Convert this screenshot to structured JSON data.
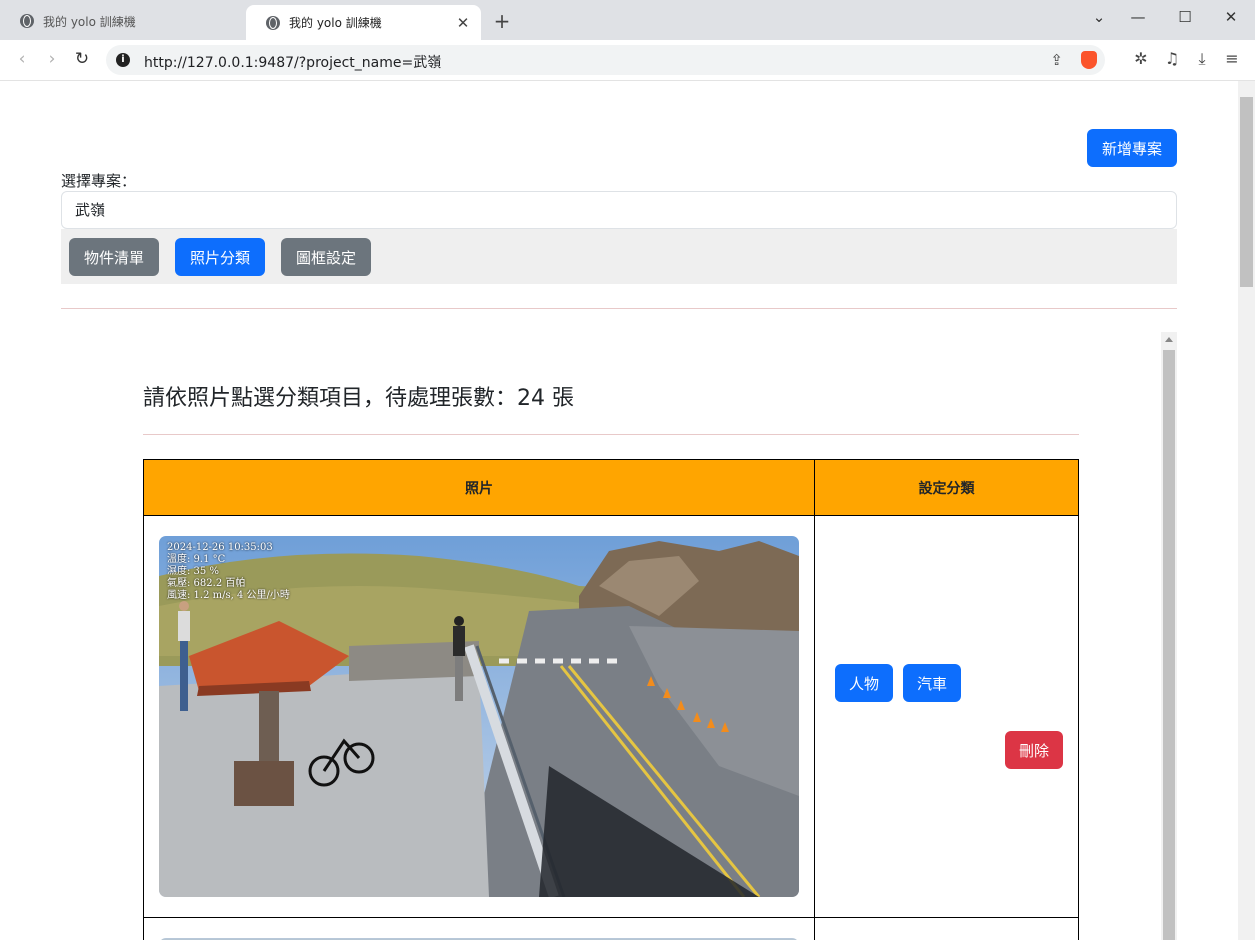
{
  "browser": {
    "tabs": [
      {
        "title": "我的 yolo 訓練機",
        "active": false
      },
      {
        "title": "我的 yolo 訓練機",
        "active": true
      }
    ],
    "url": "http://127.0.0.1:9487/?project_name=武嶺"
  },
  "page": {
    "add_project_label": "新增專案",
    "select_project_label": "選擇專案：",
    "project_value": "武嶺",
    "tabs": [
      {
        "label": "物件清單",
        "style": "secondary"
      },
      {
        "label": "照片分類",
        "style": "primary"
      },
      {
        "label": "圖框設定",
        "style": "secondary"
      }
    ]
  },
  "classify": {
    "heading": "請依照片點選分類項目，待處理張數：24 張",
    "columns": [
      "照片",
      "設定分類"
    ],
    "rows": [
      {
        "photo_overlay": [
          "2024-12-26 10:35:03",
          "溫度: 9.1 °C",
          "濕度: 35 %",
          "氣壓: 682.2 百帕",
          "風速: 1.2 m/s, 4 公里/小時"
        ],
        "class_buttons": [
          "人物",
          "汽車"
        ],
        "delete_label": "刪除"
      }
    ]
  },
  "colors": {
    "primary": "#0d6efd",
    "secondary": "#6c757d",
    "danger": "#dc3545",
    "table_header": "#ffa500"
  }
}
